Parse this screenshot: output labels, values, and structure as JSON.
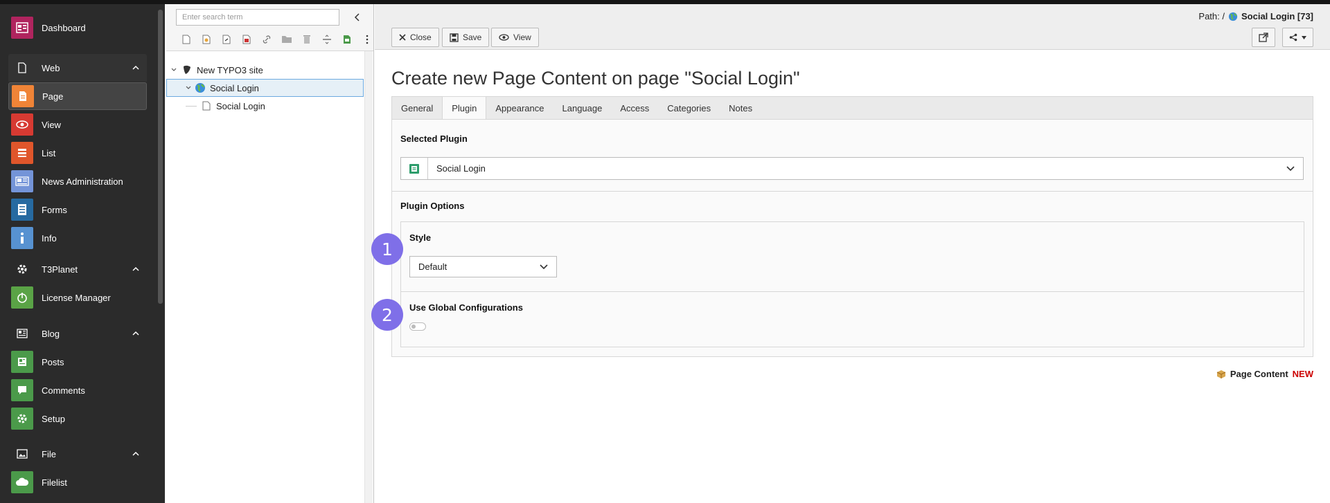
{
  "modules": {
    "dashboard": "Dashboard",
    "web_group": "Web",
    "page": "Page",
    "view": "View",
    "list": "List",
    "news": "News Administration",
    "forms": "Forms",
    "info": "Info",
    "t3planet_group": "T3Planet",
    "license": "License Manager",
    "blog_group": "Blog",
    "posts": "Posts",
    "comments": "Comments",
    "setup": "Setup",
    "file_group": "File",
    "filelist": "Filelist"
  },
  "tree": {
    "search_placeholder": "Enter search term",
    "root": "New TYPO3 site",
    "node1": "Social Login",
    "node2": "Social Login"
  },
  "header": {
    "path_label": "Path: /",
    "path_page": "Social Login [73]",
    "close": "Close",
    "save": "Save",
    "view": "View"
  },
  "main": {
    "title": "Create new Page Content on page \"Social Login\"",
    "tabs": [
      "General",
      "Plugin",
      "Appearance",
      "Language",
      "Access",
      "Categories",
      "Notes"
    ],
    "selected_plugin_label": "Selected Plugin",
    "selected_plugin_value": "Social Login",
    "plugin_options_label": "Plugin Options",
    "style_label": "Style",
    "style_value": "Default",
    "global_config_label": "Use Global Configurations",
    "global_config_enabled": false
  },
  "badges": [
    "1",
    "2"
  ],
  "footer": {
    "record_type": "Page Content",
    "status": "NEW"
  },
  "colors": {
    "sidebar_bg": "#2b2b2b",
    "badge": "#7f6fe8",
    "new": "#cc0000"
  }
}
